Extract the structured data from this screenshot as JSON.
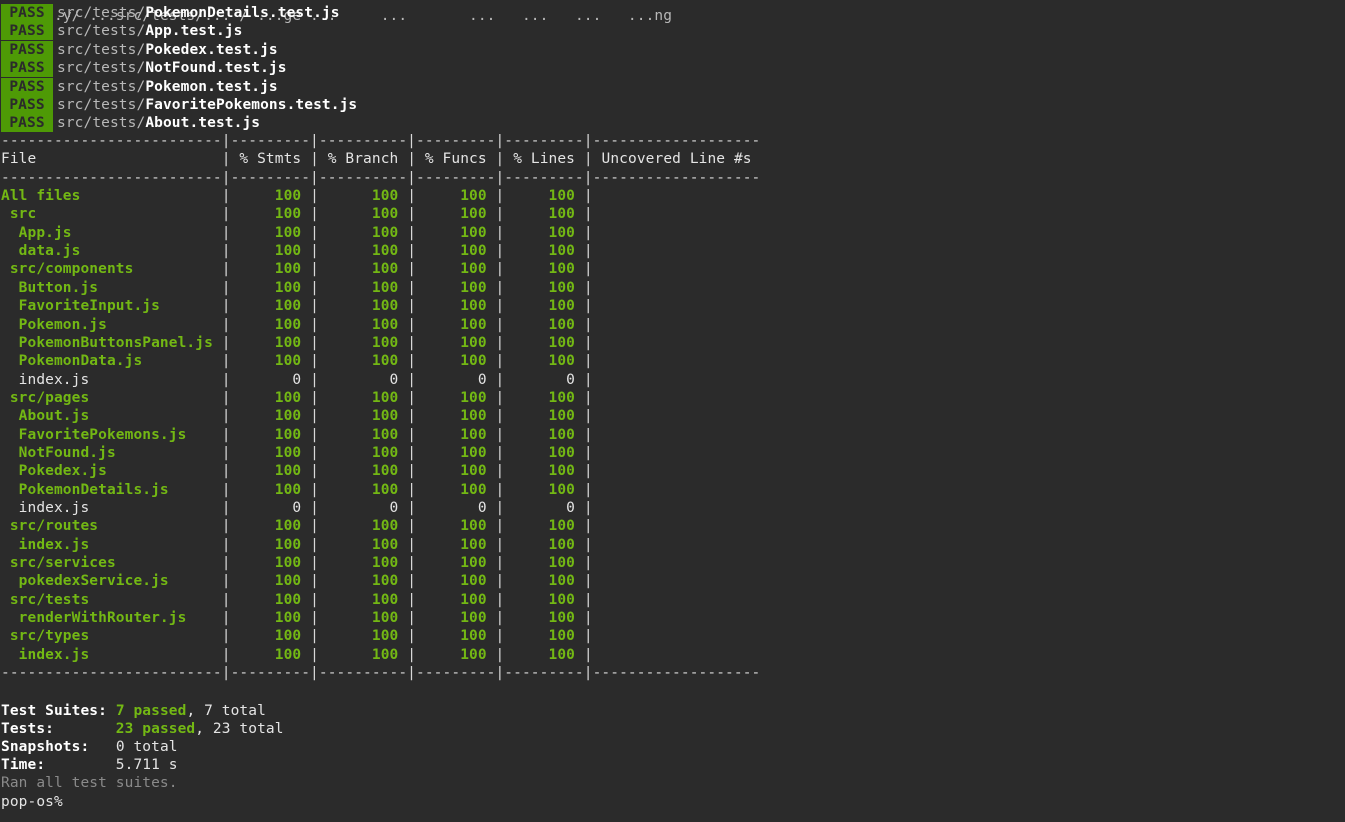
{
  "top_fragment": "...y/ ...src/tests/... / ...ge ...     ...       ...   ...   ...   ...ng",
  "pass_label": "PASS",
  "test_files": [
    {
      "dir": "src/tests/",
      "file": "PokemonDetails.test.js"
    },
    {
      "dir": "src/tests/",
      "file": "App.test.js"
    },
    {
      "dir": "src/tests/",
      "file": "Pokedex.test.js"
    },
    {
      "dir": "src/tests/",
      "file": "NotFound.test.js"
    },
    {
      "dir": "src/tests/",
      "file": "Pokemon.test.js"
    },
    {
      "dir": "src/tests/",
      "file": "FavoritePokemons.test.js"
    },
    {
      "dir": "src/tests/",
      "file": "About.test.js"
    }
  ],
  "table": {
    "rule": "-------------------------|---------|----------|---------|---------|-------------------",
    "headers": {
      "file": "File",
      "stmts": "% Stmts",
      "branch": "% Branch",
      "funcs": "% Funcs",
      "lines": "% Lines",
      "uncovered": "Uncovered Line #s"
    },
    "rows": [
      {
        "name": "All files",
        "indent": 0,
        "stmts": "100",
        "branch": "100",
        "funcs": "100",
        "lines": "100",
        "covered": true
      },
      {
        "name": "src",
        "indent": 1,
        "stmts": "100",
        "branch": "100",
        "funcs": "100",
        "lines": "100",
        "covered": true
      },
      {
        "name": "App.js",
        "indent": 2,
        "stmts": "100",
        "branch": "100",
        "funcs": "100",
        "lines": "100",
        "covered": true
      },
      {
        "name": "data.js",
        "indent": 2,
        "stmts": "100",
        "branch": "100",
        "funcs": "100",
        "lines": "100",
        "covered": true
      },
      {
        "name": "src/components",
        "indent": 1,
        "stmts": "100",
        "branch": "100",
        "funcs": "100",
        "lines": "100",
        "covered": true
      },
      {
        "name": "Button.js",
        "indent": 2,
        "stmts": "100",
        "branch": "100",
        "funcs": "100",
        "lines": "100",
        "covered": true
      },
      {
        "name": "FavoriteInput.js",
        "indent": 2,
        "stmts": "100",
        "branch": "100",
        "funcs": "100",
        "lines": "100",
        "covered": true
      },
      {
        "name": "Pokemon.js",
        "indent": 2,
        "stmts": "100",
        "branch": "100",
        "funcs": "100",
        "lines": "100",
        "covered": true
      },
      {
        "name": "PokemonButtonsPanel.js",
        "indent": 2,
        "stmts": "100",
        "branch": "100",
        "funcs": "100",
        "lines": "100",
        "covered": true
      },
      {
        "name": "PokemonData.js",
        "indent": 2,
        "stmts": "100",
        "branch": "100",
        "funcs": "100",
        "lines": "100",
        "covered": true
      },
      {
        "name": "index.js",
        "indent": 2,
        "stmts": "0",
        "branch": "0",
        "funcs": "0",
        "lines": "0",
        "covered": false
      },
      {
        "name": "src/pages",
        "indent": 1,
        "stmts": "100",
        "branch": "100",
        "funcs": "100",
        "lines": "100",
        "covered": true
      },
      {
        "name": "About.js",
        "indent": 2,
        "stmts": "100",
        "branch": "100",
        "funcs": "100",
        "lines": "100",
        "covered": true
      },
      {
        "name": "FavoritePokemons.js",
        "indent": 2,
        "stmts": "100",
        "branch": "100",
        "funcs": "100",
        "lines": "100",
        "covered": true
      },
      {
        "name": "NotFound.js",
        "indent": 2,
        "stmts": "100",
        "branch": "100",
        "funcs": "100",
        "lines": "100",
        "covered": true
      },
      {
        "name": "Pokedex.js",
        "indent": 2,
        "stmts": "100",
        "branch": "100",
        "funcs": "100",
        "lines": "100",
        "covered": true
      },
      {
        "name": "PokemonDetails.js",
        "indent": 2,
        "stmts": "100",
        "branch": "100",
        "funcs": "100",
        "lines": "100",
        "covered": true
      },
      {
        "name": "index.js",
        "indent": 2,
        "stmts": "0",
        "branch": "0",
        "funcs": "0",
        "lines": "0",
        "covered": false
      },
      {
        "name": "src/routes",
        "indent": 1,
        "stmts": "100",
        "branch": "100",
        "funcs": "100",
        "lines": "100",
        "covered": true
      },
      {
        "name": "index.js",
        "indent": 2,
        "stmts": "100",
        "branch": "100",
        "funcs": "100",
        "lines": "100",
        "covered": true
      },
      {
        "name": "src/services",
        "indent": 1,
        "stmts": "100",
        "branch": "100",
        "funcs": "100",
        "lines": "100",
        "covered": true
      },
      {
        "name": "pokedexService.js",
        "indent": 2,
        "stmts": "100",
        "branch": "100",
        "funcs": "100",
        "lines": "100",
        "covered": true
      },
      {
        "name": "src/tests",
        "indent": 1,
        "stmts": "100",
        "branch": "100",
        "funcs": "100",
        "lines": "100",
        "covered": true
      },
      {
        "name": "renderWithRouter.js",
        "indent": 2,
        "stmts": "100",
        "branch": "100",
        "funcs": "100",
        "lines": "100",
        "covered": true
      },
      {
        "name": "src/types",
        "indent": 1,
        "stmts": "100",
        "branch": "100",
        "funcs": "100",
        "lines": "100",
        "covered": true
      },
      {
        "name": "index.js",
        "indent": 2,
        "stmts": "100",
        "branch": "100",
        "funcs": "100",
        "lines": "100",
        "covered": true
      }
    ]
  },
  "summary": {
    "suites_label": "Test Suites:",
    "suites_passed": "7 passed",
    "suites_total": ", 7 total",
    "tests_label": "Tests:",
    "tests_passed": "23 passed",
    "tests_total": ", 23 total",
    "snapshots_label": "Snapshots:",
    "snapshots_value": "0 total",
    "time_label": "Time:",
    "time_value": "5.711 s",
    "ran_all": "Ran all test suites."
  },
  "prompt": "pop-os%",
  "colors": {
    "background": "#2b2b2b",
    "pass_badge": "#4e9a06",
    "covered_green": "#73b814",
    "text": "#e4e4e4",
    "muted": "#8a8a8a"
  }
}
